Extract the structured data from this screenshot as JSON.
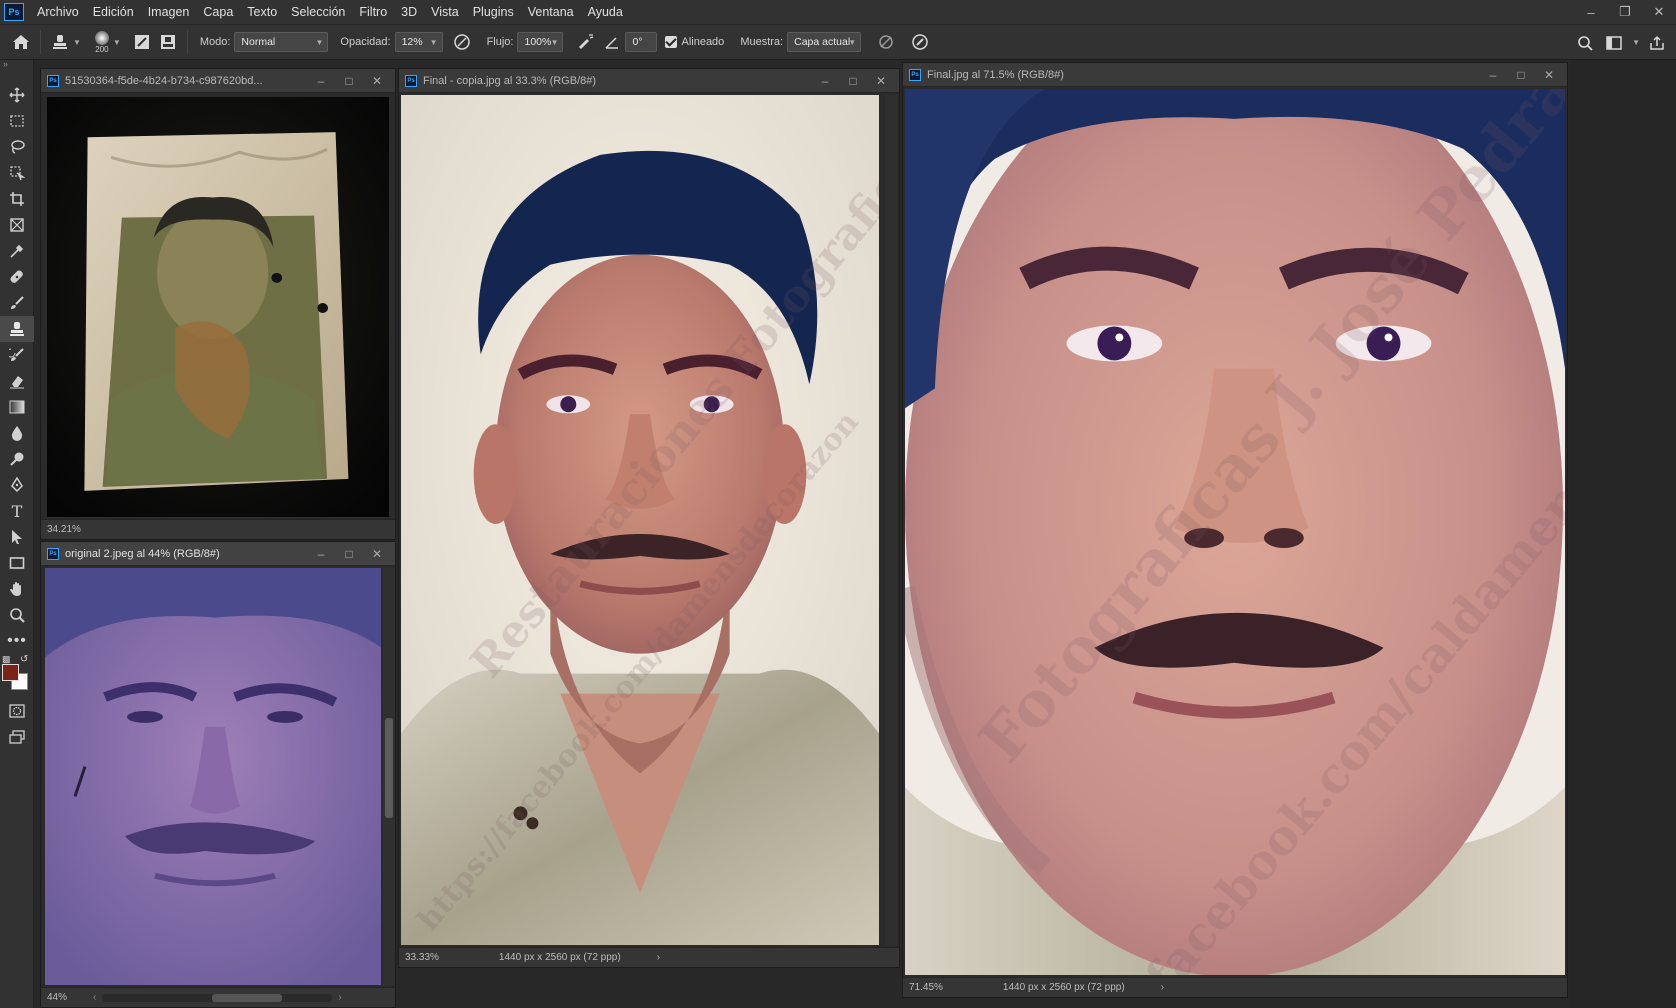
{
  "menubar": {
    "logo": "Ps",
    "items": [
      "Archivo",
      "Edición",
      "Imagen",
      "Capa",
      "Texto",
      "Selección",
      "Filtro",
      "3D",
      "Vista",
      "Plugins",
      "Ventana",
      "Ayuda"
    ]
  },
  "options": {
    "brush_size": "200",
    "mode_label": "Modo:",
    "mode_value": "Normal",
    "opacity_label": "Opacidad:",
    "opacity_value": "12%",
    "flow_label": "Flujo:",
    "flow_value": "100%",
    "angle_value": "0°",
    "aligned_label": "Alineado",
    "aligned_checked": true,
    "sample_label": "Muestra:",
    "sample_value": "Capa actual"
  },
  "colors": {
    "foreground": "#7a2418",
    "background": "#ffffff",
    "accent": "#31a8ff"
  },
  "tools": [
    "move-tool",
    "marquee-tool",
    "lasso-tool",
    "object-select-tool",
    "crop-tool",
    "frame-tool",
    "eyedropper-tool",
    "healing-brush-tool",
    "brush-tool",
    "clone-stamp-tool",
    "history-brush-tool",
    "eraser-tool",
    "gradient-tool",
    "blur-tool",
    "dodge-tool",
    "pen-tool",
    "type-tool",
    "path-select-tool",
    "rectangle-tool",
    "hand-tool",
    "zoom-tool",
    "more-tools"
  ],
  "docs": {
    "doc1": {
      "title": "51530364-f5de-4b24-b734-c987620bd...",
      "zoom": "34.21%"
    },
    "doc2": {
      "title": "original 2.jpeg al 44% (RGB/8#)",
      "zoom": "44%"
    },
    "doc3": {
      "title": "Final - copia.jpg al 33.3% (RGB/8#)",
      "zoom": "33.33%",
      "dims": "1440 px x 2560 px (72 ppp)"
    },
    "doc4": {
      "title": "Final.jpg al 71.5% (RGB/8#)",
      "zoom": "71.45%",
      "dims": "1440 px x 2560 px (72 ppp)"
    }
  }
}
